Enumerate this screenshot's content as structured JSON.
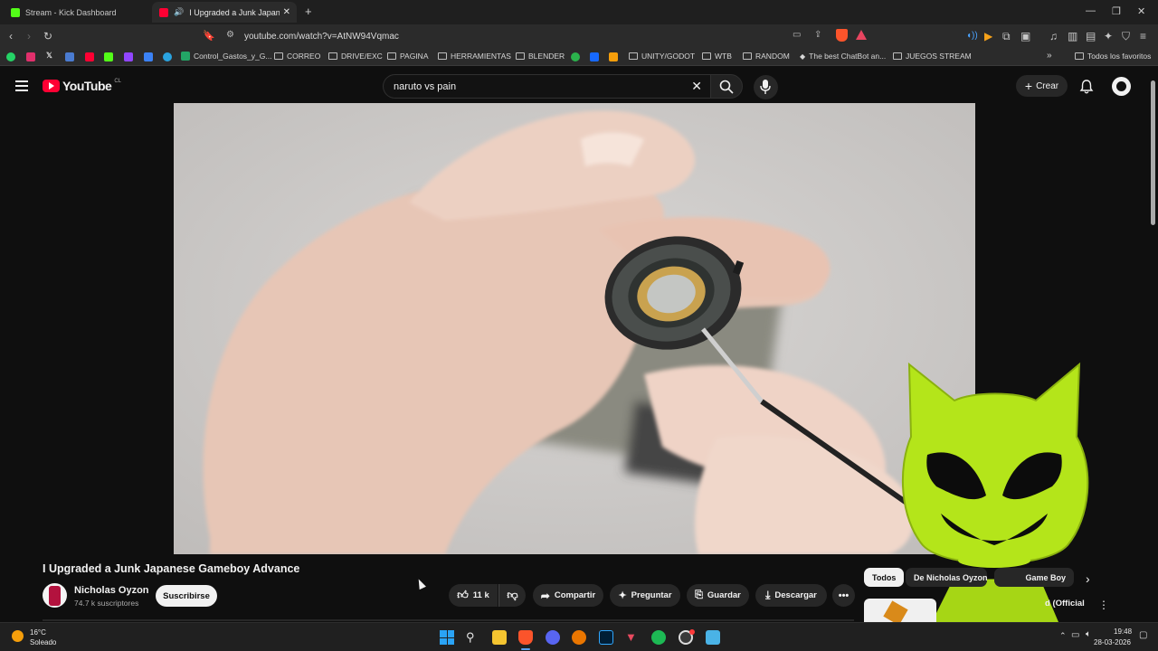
{
  "browser": {
    "tabs": [
      {
        "title": "Stream - Kick Dashboard",
        "icon": "kick-icon"
      },
      {
        "title": "I Upgraded a Junk Japanese G",
        "icon": "youtube-icon"
      }
    ],
    "url": "youtube.com/watch?v=AtNW94Vqmac",
    "bookmarks": [
      {
        "label": "Control_Gastos_y_G...",
        "kind": "sheets-icon"
      },
      {
        "label": "CORREO",
        "kind": "folder-icon"
      },
      {
        "label": "DRIVE/EXC",
        "kind": "folder-icon"
      },
      {
        "label": "PAGINA",
        "kind": "folder-icon"
      },
      {
        "label": "HERRAMIENTAS",
        "kind": "folder-icon"
      },
      {
        "label": "BLENDER",
        "kind": "folder-icon"
      },
      {
        "label": "UNITY/GODOT",
        "kind": "folder-icon"
      },
      {
        "label": "WTB",
        "kind": "folder-icon"
      },
      {
        "label": "RANDOM",
        "kind": "folder-icon"
      },
      {
        "label": "The best ChatBot an...",
        "kind": "chatbot-icon"
      },
      {
        "label": "JUEGOS STREAM",
        "kind": "folder-icon"
      }
    ],
    "all_favorites": "Todos los favoritos"
  },
  "youtube": {
    "logo_text": "YouTube",
    "region": "CL",
    "search_query": "naruto vs pain",
    "create_label": "Crear",
    "video": {
      "title": "I Upgraded a Junk Japanese Gameboy Advance",
      "channel": "Nicholas Oyzon",
      "subscribers": "74.7 k suscriptores",
      "subscribe_label": "Suscribirse",
      "likes": "11 k",
      "share_label": "Compartir",
      "ask_label": "Preguntar",
      "save_label": "Guardar",
      "download_label": "Descargar"
    },
    "chips": [
      "Todos",
      "De Nicholas Oyzon",
      "Game Boy"
    ],
    "up_next_partial": "d (Official"
  },
  "taskbar": {
    "weather_temp": "16°C",
    "weather_desc": "Soleado",
    "time": "19:48",
    "date": "28-03-2026"
  },
  "colors": {
    "accent_red": "#ff0033",
    "mascot_green": "#b4e51a",
    "bg": "#0f0f0f"
  }
}
